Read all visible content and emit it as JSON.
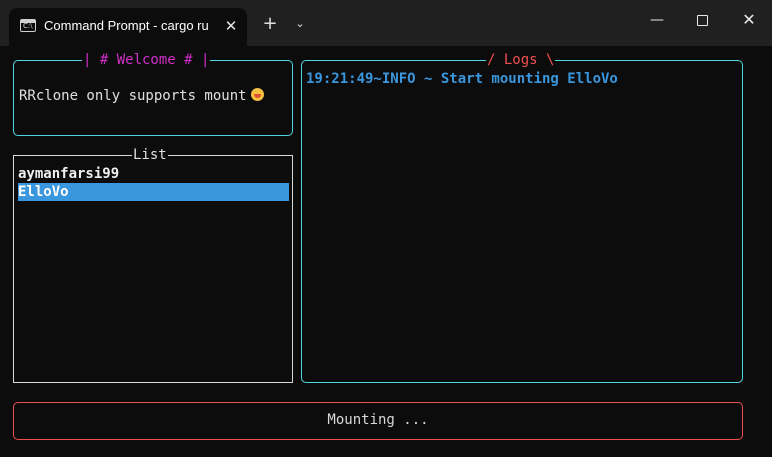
{
  "window": {
    "tab_title": "Command Prompt - cargo  ru",
    "tab_icon": "terminal-icon",
    "tab_icon_prompt": "C:\\",
    "close_tab": "✕",
    "new_tab": "+",
    "dropdown": "⌄",
    "minimize": "—",
    "close": "✕"
  },
  "welcome": {
    "title": "| # Welcome # |",
    "message": "RRclone only supports mount",
    "emoji": "grimacing-face"
  },
  "list": {
    "title": "List",
    "items": [
      "aymanfarsi99",
      "ElloVo"
    ],
    "selected_index": 1
  },
  "logs": {
    "title": "/ Logs \\",
    "lines": [
      "19:21:49~INFO ~ Start mounting ElloVo"
    ]
  },
  "status": {
    "text": "Mounting ..."
  },
  "colors": {
    "welcome_border": "#50d6e0",
    "welcome_title": "#d030c8",
    "logs_title": "#f05050",
    "status_border": "#f05050",
    "selected_bg": "#3a96dd",
    "log_text": "#3a96dd"
  }
}
